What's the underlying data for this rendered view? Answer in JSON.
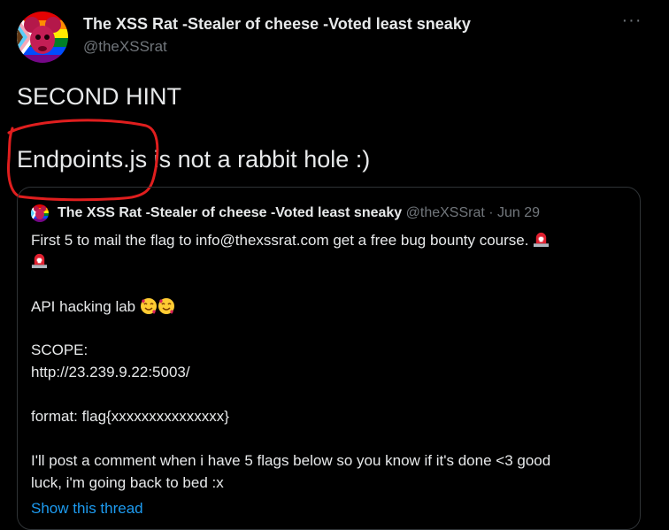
{
  "author": {
    "display_name": "The XSS Rat -Stealer of cheese -Voted least sneaky",
    "handle": "@theXSSrat",
    "more_label": "···"
  },
  "tweet": {
    "line1": "SECOND HINT",
    "line2_highlighted": "Endpoints.js",
    "line2_rest": " is not a rabbit hole :)"
  },
  "quoted_tweet": {
    "display_name": "The XSS Rat -Stealer of cheese -Voted least sneaky",
    "handle_date": "@theXSSrat · Jun 29",
    "line1": "First 5 to mail the flag to info@thexssrat.com get a free bug bounty course.",
    "line3": "API hacking lab",
    "line4": "SCOPE:",
    "line5": "http://23.239.9.22:5003/",
    "line6": "format: flag{xxxxxxxxxxxxxxx}",
    "line7": "I'll post a comment when i have 5 flags below so you know if it's done <3 good",
    "line8": "luck, i'm going back to bed :x",
    "show_thread": "Show this thread"
  },
  "colors": {
    "background": "#000000",
    "text": "#e7e9ea",
    "secondary": "#71767b",
    "link": "#1d9bf0",
    "annotation": "#e01e1e"
  },
  "icons": {
    "avatar": "rat-avatar-icon",
    "more": "more-dots-icon",
    "siren": "police-siren-emoji",
    "hug": "smiling-hearts-emoji"
  }
}
